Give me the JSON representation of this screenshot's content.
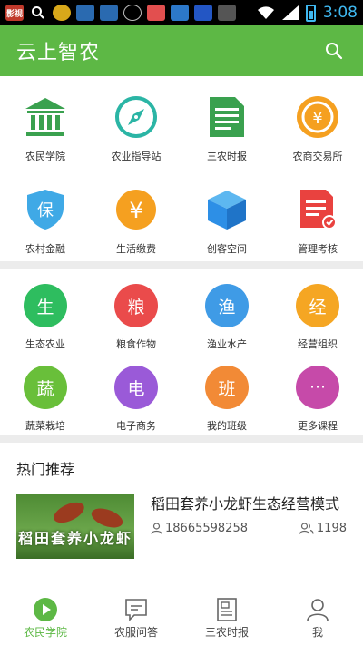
{
  "status_bar": {
    "icons": [
      "news-app-icon",
      "search-icon",
      "app-icon",
      "app-icon",
      "app-icon",
      "cat-icon",
      "app-icon",
      "app-icon",
      "baidu-icon",
      "app-icon"
    ],
    "time": "3:08"
  },
  "header": {
    "title": "云上智农",
    "search_icon": "search-icon"
  },
  "services": [
    {
      "label": "农民学院",
      "icon": "building-icon",
      "color": "#3aa14f"
    },
    {
      "label": "农业指导站",
      "icon": "compass-icon",
      "color": "#2bb5a5"
    },
    {
      "label": "三农时报",
      "icon": "document-icon",
      "color": "#3aa14f"
    },
    {
      "label": "农商交易所",
      "icon": "coin-icon",
      "color": "#f5a020"
    },
    {
      "label": "农村金融",
      "icon": "shield-icon",
      "color": "#3fa9e6"
    },
    {
      "label": "生活缴费",
      "icon": "yen-badge-icon",
      "color": "#f5a020"
    },
    {
      "label": "创客空间",
      "icon": "cube-icon",
      "color": "#2d8fe6"
    },
    {
      "label": "管理考核",
      "icon": "report-icon",
      "color": "#e9423f"
    }
  ],
  "categories": [
    {
      "glyph": "生",
      "label": "生态农业",
      "color": "#2ebd5f"
    },
    {
      "glyph": "粮",
      "label": "粮食作物",
      "color": "#ea4b4b"
    },
    {
      "glyph": "渔",
      "label": "渔业水产",
      "color": "#3f9be6"
    },
    {
      "glyph": "经",
      "label": "经营组织",
      "color": "#f5a623"
    },
    {
      "glyph": "蔬",
      "label": "蔬菜栽培",
      "color": "#69bf3a"
    },
    {
      "glyph": "电",
      "label": "电子商务",
      "color": "#9a5ad8"
    },
    {
      "glyph": "班",
      "label": "我的班级",
      "color": "#f28a36"
    },
    {
      "glyph": "···",
      "label": "更多课程",
      "color": "#c64aa9"
    }
  ],
  "hot": {
    "title": "热门推荐",
    "article": {
      "thumb_text": "稻田套养小龙虾",
      "title": "稻田套养小龙虾生态经营模式",
      "author": "18665598258",
      "views": "1198"
    }
  },
  "bottom_nav": [
    {
      "label": "农民学院",
      "icon": "play-icon",
      "active": true
    },
    {
      "label": "农服问答",
      "icon": "chat-icon",
      "active": false
    },
    {
      "label": "三农时报",
      "icon": "newspaper-icon",
      "active": false
    },
    {
      "label": "我",
      "icon": "person-icon",
      "active": false
    }
  ],
  "colors": {
    "brand": "#5db845",
    "background": "#ececec"
  }
}
